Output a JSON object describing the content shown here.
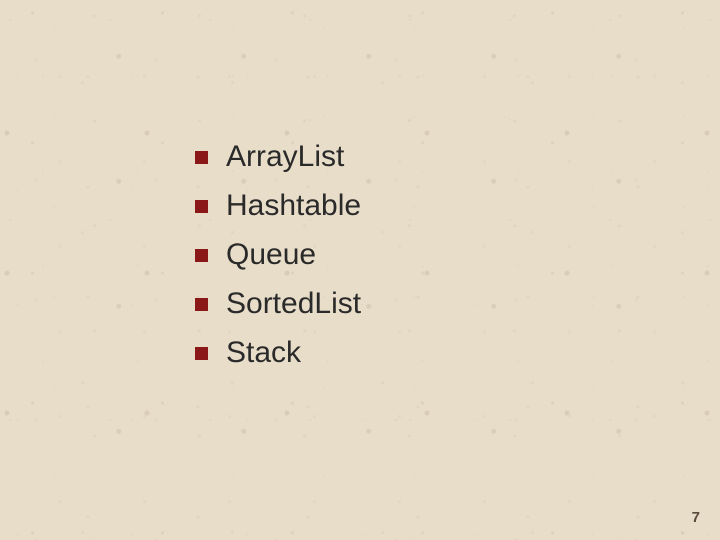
{
  "slide": {
    "bullets": [
      "ArrayList",
      "Hashtable",
      "Queue",
      "SortedList",
      "Stack"
    ],
    "pageNumber": "7"
  },
  "colors": {
    "bullet": "#8b1818",
    "background": "#e8ddc9"
  }
}
